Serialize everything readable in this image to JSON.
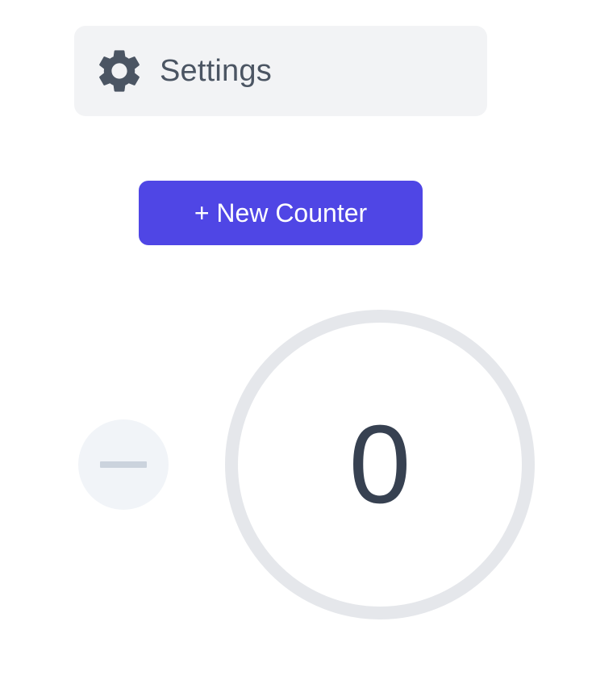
{
  "settings": {
    "label": "Settings",
    "icon": "gear-icon"
  },
  "toolbar": {
    "new_counter_label": "+ New Counter"
  },
  "counter": {
    "value": "0",
    "decrement_icon": "minus-icon"
  },
  "colors": {
    "accent": "#4f46e5",
    "settings_bg": "#f2f3f5",
    "ring": "#e5e7eb",
    "text_dark": "#374151",
    "minus_bg": "#f1f4f8",
    "minus_glyph": "#cbd3dd"
  }
}
